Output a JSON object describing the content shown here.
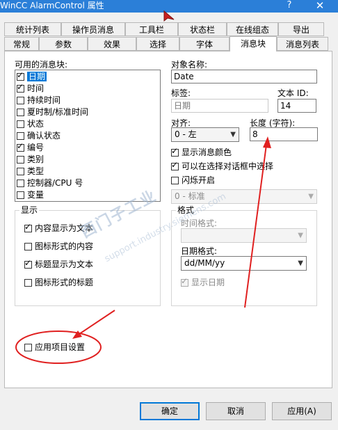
{
  "window": {
    "title": "WinCC AlarmControl 属性",
    "help": "?",
    "close": "✕"
  },
  "tabs_back": [
    "统计列表",
    "操作员消息",
    "工具栏",
    "状态栏",
    "在线组态",
    "导出"
  ],
  "tabs_front": [
    "常规",
    "参数",
    "效果",
    "选择",
    "字体",
    "消息块",
    "消息列表"
  ],
  "active_tab": "消息块",
  "blocks": {
    "label": "可用的消息块:",
    "items": [
      {
        "label": "日期",
        "checked": "✓"
      },
      {
        "label": "时间",
        "checked": "✓"
      },
      {
        "label": "持续时间",
        "checked": ""
      },
      {
        "label": "夏时制/标准时间",
        "checked": ""
      },
      {
        "label": "状态",
        "checked": ""
      },
      {
        "label": "确认状态",
        "checked": ""
      },
      {
        "label": "编号",
        "checked": "✓"
      },
      {
        "label": "类别",
        "checked": ""
      },
      {
        "label": "类型",
        "checked": ""
      },
      {
        "label": "控制器/CPU 号",
        "checked": ""
      },
      {
        "label": "变量",
        "checked": ""
      }
    ]
  },
  "object_name": {
    "label": "对象名称:",
    "value": "Date"
  },
  "tag_label": {
    "label": "标签:",
    "value": "日期"
  },
  "text_id": {
    "label": "文本 ID:",
    "value": "14"
  },
  "align": {
    "label": "对齐:",
    "value": "0 - 左"
  },
  "length": {
    "label": "长度 (字符):",
    "value": "8"
  },
  "show_msg_color": {
    "label": "显示消息颜色",
    "checked": "✓"
  },
  "selectable_in_dialog": {
    "label": "可以在选择对话框中选择",
    "checked": "✓"
  },
  "flash_on": {
    "label": "闪烁开启",
    "checked": ""
  },
  "flash_select": {
    "value": "0 - 标准"
  },
  "display_group": {
    "legend": "显示",
    "content_as_text": {
      "label": "内容显示为文本",
      "checked": "✓"
    },
    "content_as_icon": {
      "label": "图标形式的内容",
      "checked": ""
    },
    "title_as_text": {
      "label": "标题显示为文本",
      "checked": "✓"
    },
    "title_as_icon": {
      "label": "图标形式的标题",
      "checked": ""
    }
  },
  "format_group": {
    "legend": "格式",
    "time_format_label": "时间格式:",
    "time_format_value": "",
    "date_format_label": "日期格式:",
    "date_format_value": "dd/MM/yy",
    "show_date": {
      "label": "显示日期",
      "checked": "✓"
    }
  },
  "apply_project": {
    "label": "应用项目设置",
    "checked": ""
  },
  "buttons": {
    "ok": "确定",
    "cancel": "取消",
    "apply": "应用(A)"
  },
  "watermark": {
    "line1": "西门子工业",
    "line2": "support.industry.siemens.com"
  },
  "annotation_color": "#e02020"
}
